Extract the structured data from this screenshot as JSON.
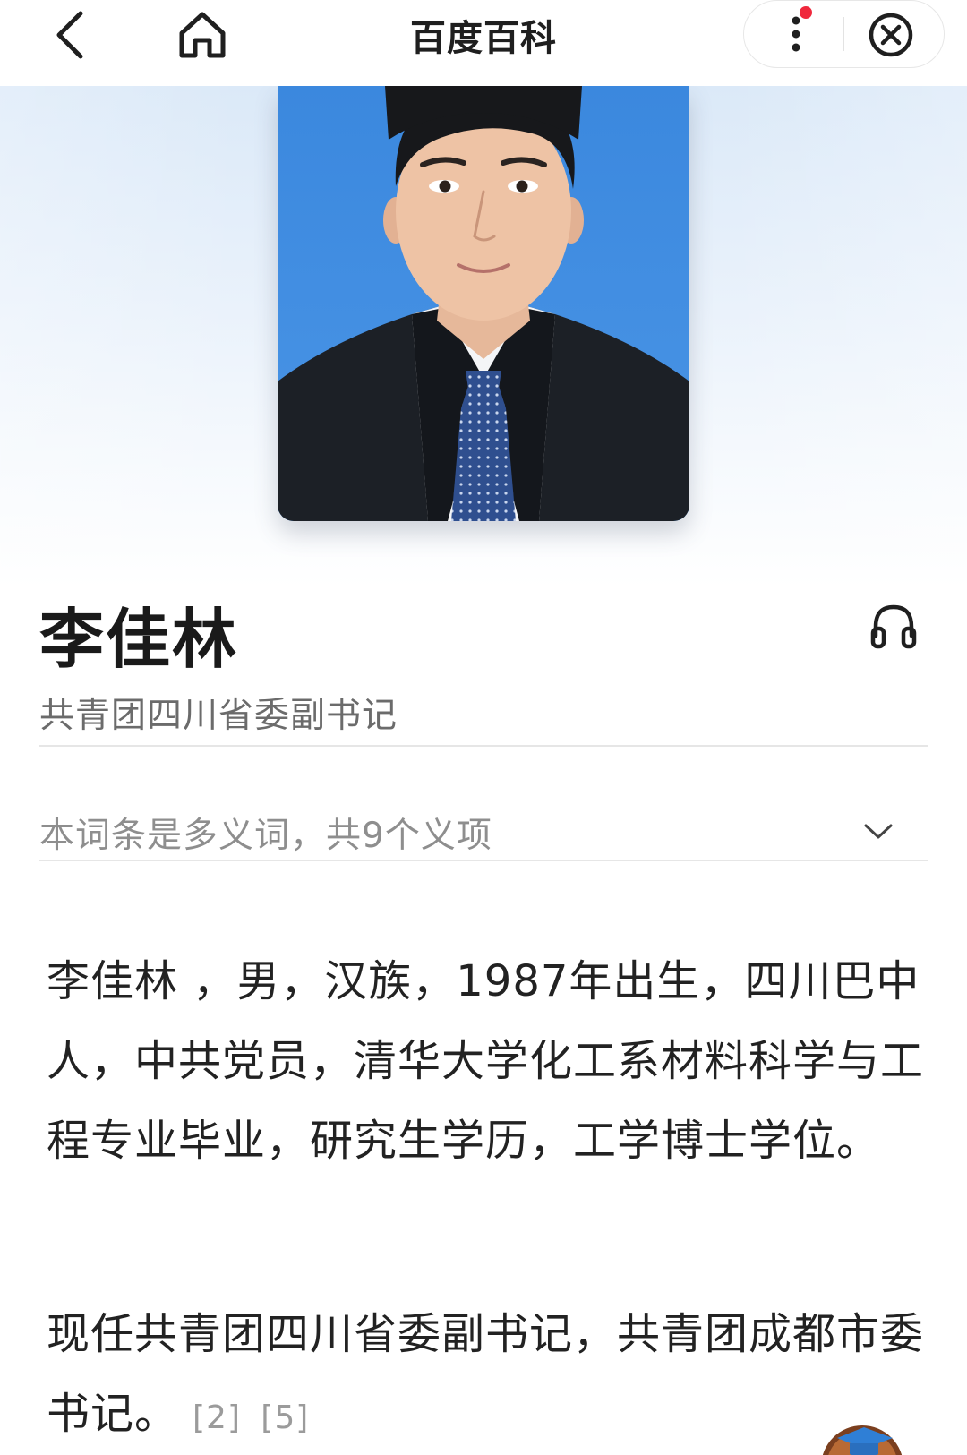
{
  "topbar": {
    "back_icon": "chevron-left-icon",
    "home_icon": "home-icon",
    "title": "百度百科",
    "more_icon": "vertical-dots-icon",
    "close_icon": "close-circle-icon",
    "notification_color": "#f0283c"
  },
  "header": {
    "name": "李佳林",
    "subtitle": "共青团四川省委副书记",
    "listen_icon": "headphones-icon",
    "polysemy_text": "本词条是多义词，共9个义项",
    "polysemy_icon": "chevron-down-icon"
  },
  "body": {
    "paragraph1": "李佳林 ，男，汉族，1987年出生，四川巴中人，中共党员，清华大学化工系材料科学与工程专业毕业，研究生学历，工学博士学位。",
    "paragraph2_text": "现任共青团四川省委副书记，共青团成都市委书记。",
    "refs": [
      "[2]",
      "[5]"
    ]
  },
  "colors": {
    "portrait_background": "#3f8de0",
    "hero_gradient_top": "#dbe9f8",
    "text_primary": "#1f1f1f",
    "text_secondary": "#6b6b6b"
  }
}
